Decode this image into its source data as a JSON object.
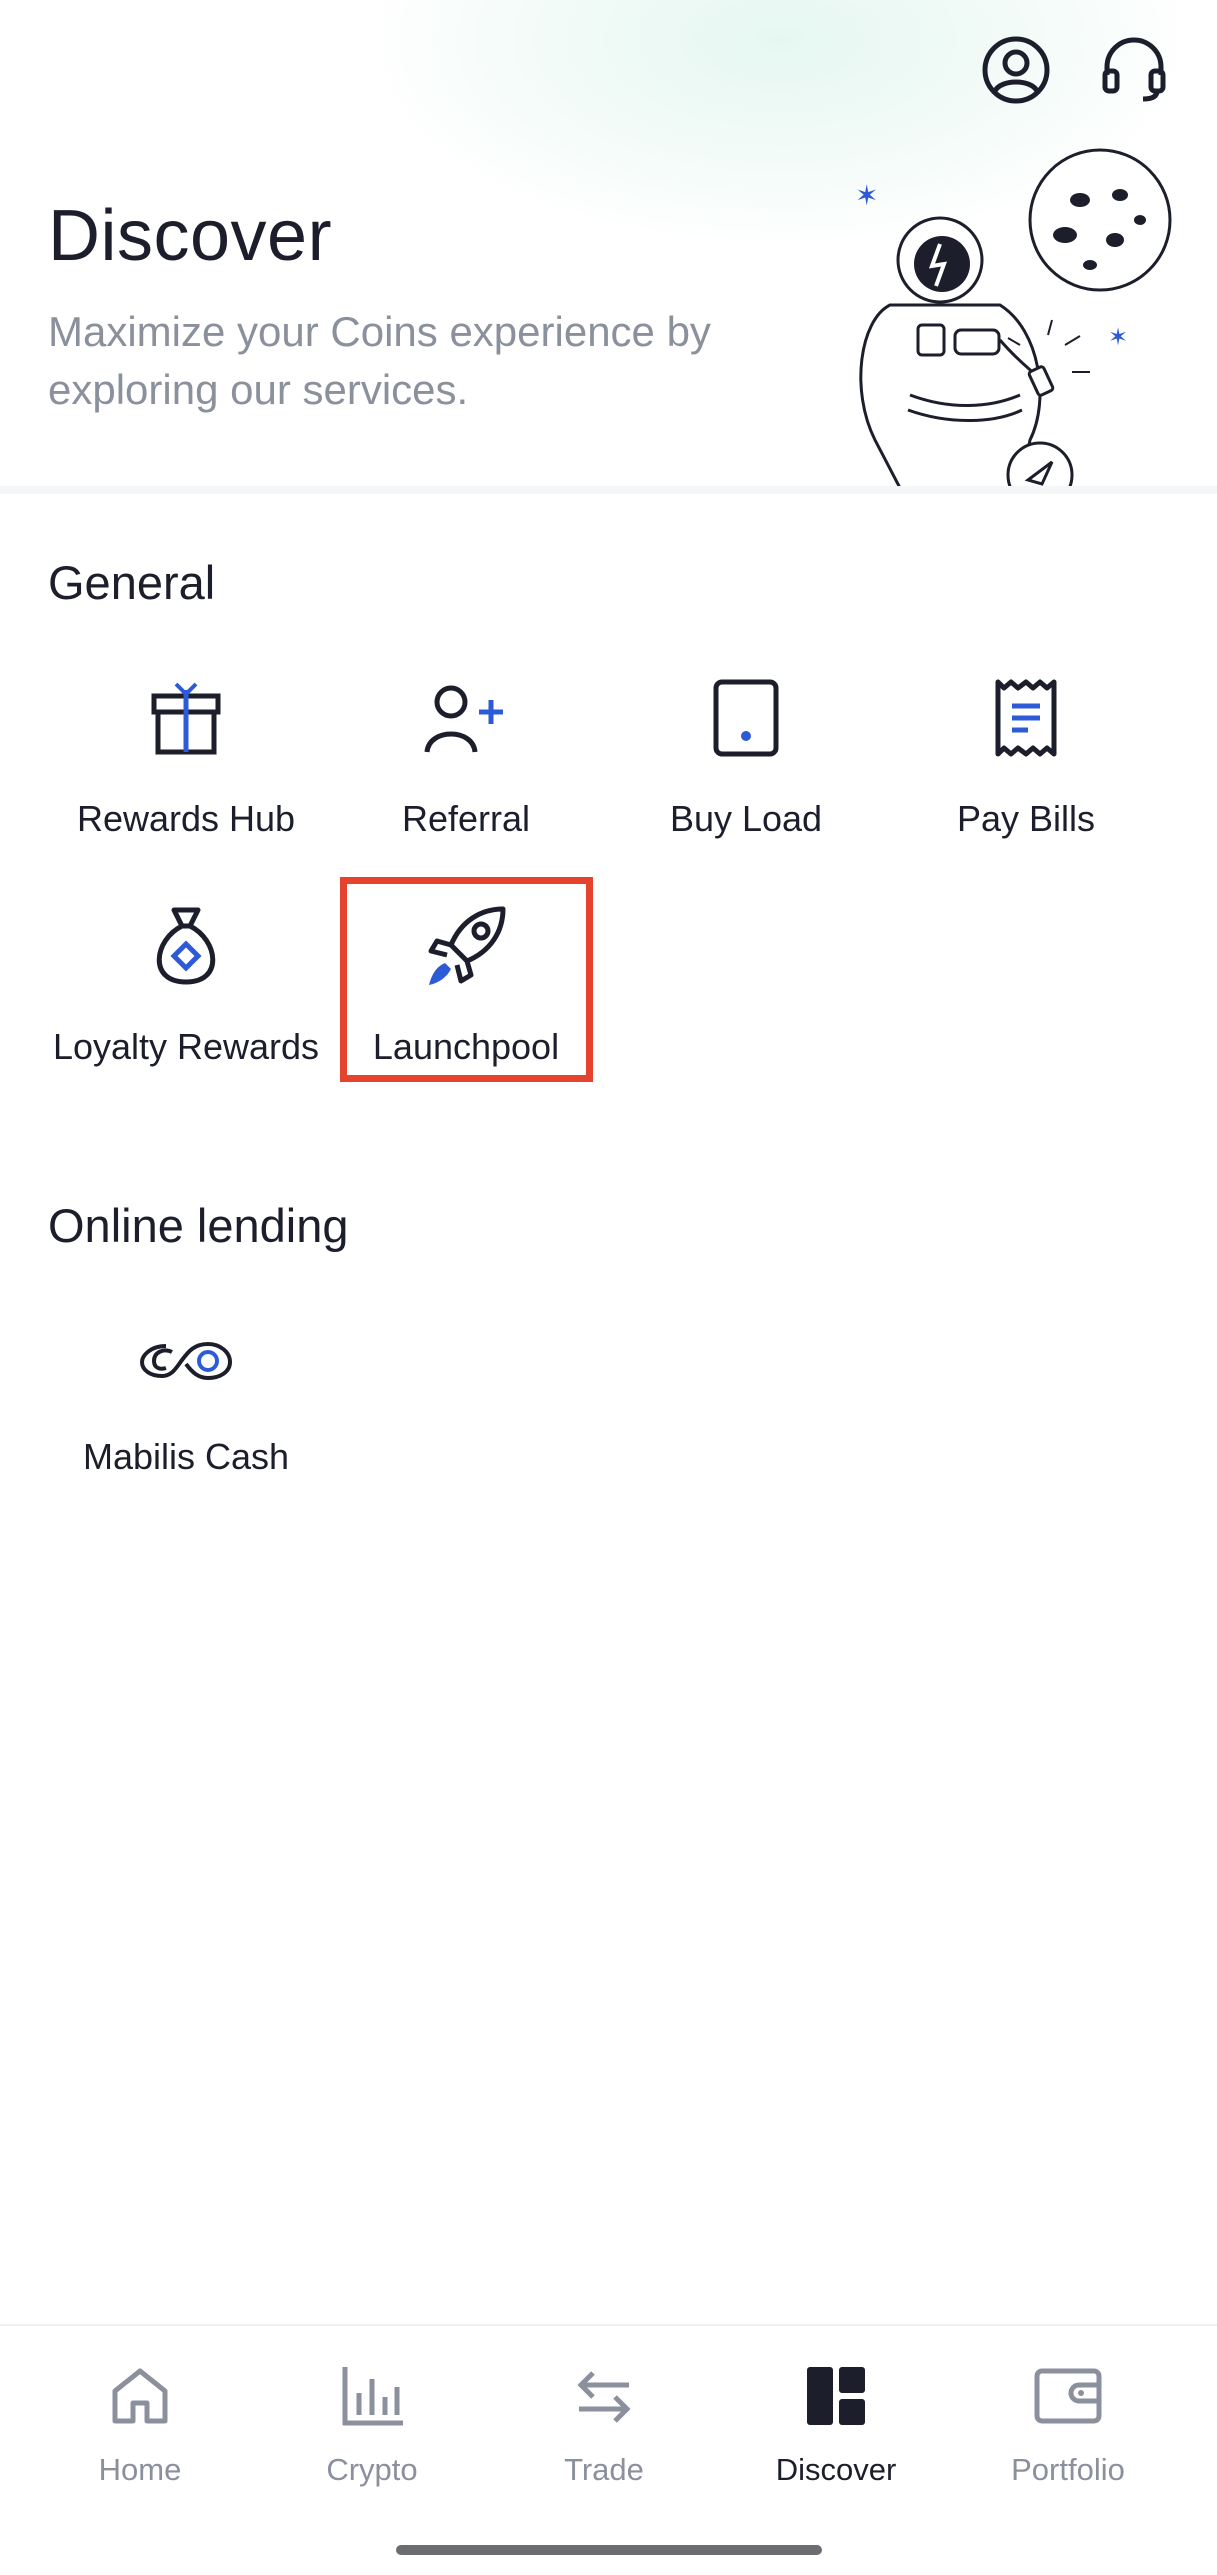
{
  "header": {
    "title": "Discover",
    "subtitle": "Maximize your Coins experience by exploring our services."
  },
  "top_icons": [
    "profile-icon",
    "support-headset-icon"
  ],
  "sections": {
    "general": {
      "title": "General",
      "items": [
        {
          "label": "Rewards Hub",
          "icon": "gift-icon"
        },
        {
          "label": "Referral",
          "icon": "add-user-icon"
        },
        {
          "label": "Buy Load",
          "icon": "phone-icon"
        },
        {
          "label": "Pay Bills",
          "icon": "receipt-icon"
        },
        {
          "label": "Loyalty Rewards",
          "icon": "money-bag-icon"
        },
        {
          "label": "Launchpool",
          "icon": "rocket-icon"
        }
      ]
    },
    "online_lending": {
      "title": "Online lending",
      "items": [
        {
          "label": "Mabilis Cash",
          "icon": "mabilis-cash-logo"
        }
      ]
    }
  },
  "tabbar": {
    "items": [
      {
        "label": "Home",
        "icon": "home-icon",
        "active": false
      },
      {
        "label": "Crypto",
        "icon": "bar-chart-icon",
        "active": false
      },
      {
        "label": "Trade",
        "icon": "swap-arrows-icon",
        "active": false
      },
      {
        "label": "Discover",
        "icon": "dashboard-grid-icon",
        "active": true
      },
      {
        "label": "Portfolio",
        "icon": "wallet-icon",
        "active": false
      }
    ]
  },
  "colors": {
    "accent": "#2d5bd7",
    "text": "#1c1f2b",
    "muted": "#8a909c",
    "highlight": "#e5432d"
  }
}
